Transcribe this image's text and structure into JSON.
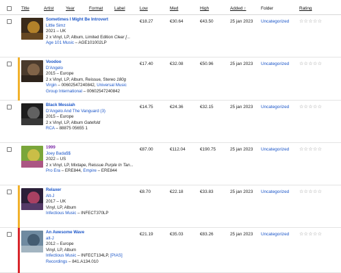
{
  "header": {
    "title": "Title",
    "artist": "Artist",
    "year": "Year",
    "format": "Format",
    "label": "Label",
    "low": "Low",
    "med": "Med",
    "high": "High",
    "added": "Added ↑",
    "folder": "Folder",
    "rating": "Rating"
  },
  "rows": [
    {
      "title": "Sometimes I Might Be Introvert",
      "artist": "Little Simz",
      "year_country": "2021 – UK",
      "format_plain": "2 x Vinyl, LP, Album, Limited Edition ",
      "format_italic": "Clear [...",
      "label_link": "Age 101 Music",
      "label_cat": " – AGE101002LP",
      "low": "€18.27",
      "med": "€30.64",
      "high": "€43.50",
      "added": "25 jan 2023",
      "folder": "Uncategorized",
      "stars": "☆☆☆☆☆",
      "bar_color": "",
      "cover": [
        "#3a2a1a",
        "#c8912e",
        "#6b4a22"
      ]
    },
    {
      "title": "Voodoo",
      "artist": "D'Angelo",
      "year_country": "2015 – Europe",
      "format_plain": "2 x Vinyl, LP, Album, Reissue, Stereo ",
      "format_italic": "180g",
      "label_link": "Virgin",
      "label_cat": " – 00602547240842, ",
      "label_link2": "Universal Music Group International",
      "label_cat2": " – 00602547240842",
      "low": "€17.40",
      "med": "€32.08",
      "high": "€50.96",
      "added": "25 jan 2023",
      "folder": "Uncategorized",
      "stars": "☆☆☆☆☆",
      "bar_color": "#f2b12b",
      "cover": [
        "#4a3a2c",
        "#8a6b4e",
        "#2a211a"
      ]
    },
    {
      "title": "Black Messiah",
      "artist": "D'Angelo And The Vanguard (3)",
      "year_country": "2015 – Europe",
      "format_plain": "2 x Vinyl, LP, Album ",
      "format_italic": "Gatefold",
      "label_link": "RCA",
      "label_cat": " – 88875 05655 1",
      "low": "€14.75",
      "med": "€24.36",
      "high": "€32.15",
      "added": "25 jan 2023",
      "folder": "Uncategorized",
      "stars": "☆☆☆☆☆",
      "bar_color": "",
      "cover": [
        "#1d1d1d",
        "#6d6d6d",
        "#3b3b3b"
      ]
    },
    {
      "title": "1999",
      "artist": "Joey Bada$$",
      "year_country": "2022 – US",
      "format_plain": "2 x Vinyl, LP, Mixtape, Reissue ",
      "format_italic": "Purple In Tan...",
      "label_link": "Pro Era",
      "label_cat": " – ERE844, ",
      "label_link2": "Empire",
      "label_cat2": " – ERE844",
      "low": "€87.00",
      "med": "€112.04",
      "high": "€190.75",
      "added": "25 jan 2023",
      "folder": "Uncategorized",
      "stars": "☆☆☆☆☆",
      "bar_color": "",
      "cover": [
        "#7aa63a",
        "#d8c24a",
        "#b04e8c"
      ]
    },
    {
      "title": "Relaxer",
      "artist": "Alt-J",
      "year_country": "2017 – UK",
      "format_plain": "Vinyl, LP, Album",
      "format_italic": "",
      "label_link": "Infectious Music",
      "label_cat": " – INFECT370LP",
      "low": "€8.70",
      "med": "€22.18",
      "high": "€33.83",
      "added": "25 jan 2023",
      "folder": "Uncategorized",
      "stars": "☆☆☆☆☆",
      "bar_color": "#f2b12b",
      "cover": [
        "#2b1f38",
        "#c0486a",
        "#5a3d6e"
      ]
    },
    {
      "title": "An Awesome Wave",
      "artist": "alt-J",
      "year_country": "2012 – Europe",
      "format_plain": "Vinyl, LP, Album",
      "format_italic": "",
      "label_link": "Infectious Music",
      "label_cat": " – INFECT134LP, ",
      "label_link2": "[PIAS] Recordings",
      "label_cat2": " – 841.A134.010",
      "low": "€21.19",
      "med": "€35.03",
      "high": "€83.26",
      "added": "25 jan 2023",
      "folder": "Uncategorized",
      "stars": "☆☆☆☆☆",
      "bar_color": "#d8262b",
      "cover": [
        "#6f8aa0",
        "#3d5468",
        "#a8b9c4"
      ]
    }
  ]
}
